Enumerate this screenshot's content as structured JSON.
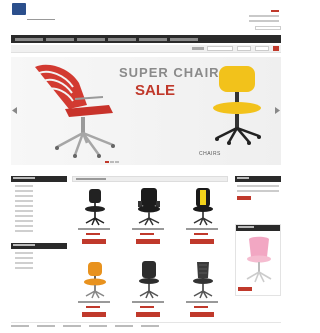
{
  "brand": {
    "name": "",
    "subtitle": "",
    "tagline": "",
    "colors": {
      "accent": "#c0392b",
      "nav": "#2a2a2a",
      "logo": "#2b4f8c"
    }
  },
  "header": {
    "top_links": [
      "",
      "",
      ""
    ],
    "search_placeholder": ""
  },
  "nav": {
    "items": [
      "",
      "",
      "",
      "",
      "",
      ""
    ]
  },
  "filter_bar": {
    "label": "",
    "field1": "",
    "field2": "",
    "field3": "",
    "go": ""
  },
  "banner": {
    "headline_1": "SUPER CHAIR",
    "headline_2": "SALE",
    "caption": "CHAIRS"
  },
  "sidebar": {
    "categories_title": "",
    "categories": [
      "",
      "",
      "",
      "",
      "",
      "",
      "",
      "",
      "",
      ""
    ],
    "info_title": "",
    "info_items": [
      "",
      "",
      "",
      ""
    ]
  },
  "main": {
    "section_title": "",
    "products": [
      {
        "name": "",
        "price": "",
        "button": "",
        "icon": "task-chair-icon"
      },
      {
        "name": "",
        "price": "",
        "button": "",
        "icon": "executive-chair-icon"
      },
      {
        "name": "",
        "price": "",
        "button": "",
        "icon": "racing-chair-icon"
      },
      {
        "name": "",
        "price": "",
        "button": "",
        "icon": "orange-chair-icon"
      },
      {
        "name": "",
        "price": "",
        "button": "",
        "icon": "office-chair-icon"
      },
      {
        "name": "",
        "price": "",
        "button": "",
        "icon": "mesh-chair-icon"
      }
    ]
  },
  "cart": {
    "title": "",
    "lines": [
      "",
      ""
    ],
    "button": ""
  },
  "featured": {
    "title": "",
    "button": ""
  },
  "footer": {
    "links": [
      "",
      "",
      "",
      "",
      "",
      ""
    ]
  }
}
